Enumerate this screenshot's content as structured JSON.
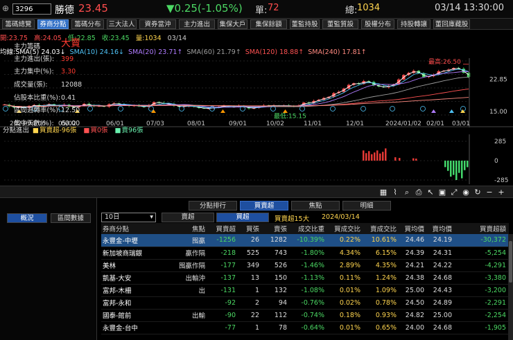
{
  "quote": {
    "code": "3296",
    "name": "勝德",
    "price": "23.45",
    "change": "▼0.25(-1.05%)",
    "vol_label": "單:",
    "vol": "72",
    "total_label": "總:",
    "total": "1034",
    "datetime": "03/14 13:30:00"
  },
  "tabs": [
    "籌碼總覽",
    "券商分點",
    "籌碼分布",
    "三大法人",
    "資券當沖",
    "主力進出",
    "集保大戶",
    "集保餘額",
    "董監持股",
    "董監質設",
    "股權分布",
    "持股轉讓",
    "董回庫藏股"
  ],
  "tab_active": 1,
  "price_bar": {
    "open": "開:23.75",
    "high": "高:24.05",
    "low": "低:22.85",
    "close": "收:23.45",
    "vol": "量:1034",
    "date": "03/14"
  },
  "ma_legend": [
    {
      "label": "均線:SMA(5) 24.03↓",
      "color": "#ffffff"
    },
    {
      "label": "SMA(10) 24.16↓",
      "color": "#4fc3f7"
    },
    {
      "label": "SMA(20) 23.71↑",
      "color": "#b07cff"
    },
    {
      "label": "SMA(60) 21.79↑",
      "color": "#9e9e9e"
    },
    {
      "label": "SMA(120) 18.88↑",
      "color": "#ff5252"
    },
    {
      "label": "SMA(240) 17.81↑",
      "color": "#ff8a80"
    }
  ],
  "chart_data": {
    "type": "candlestick",
    "x_ticks": [
      "2023/04/06",
      "05/02",
      "06/01",
      "07/03",
      "08/01",
      "09/01",
      "10/02",
      "11/01",
      "12/01",
      "2024/01/02",
      "02/01",
      "03/01"
    ],
    "y_ticks": [
      "22.85",
      "15.00"
    ],
    "annotations": {
      "high": "最高:26.50",
      "low": "最低:15.15"
    },
    "closes": [
      16.7,
      16.3,
      16.0,
      16.1,
      15.9,
      16.4,
      16.6,
      16.3,
      16.6,
      16.8,
      16.5,
      16.4,
      16.7,
      16.2,
      16.1,
      16.4,
      16.9,
      16.6,
      16.3,
      16.4,
      16.2,
      16.8,
      17.0,
      16.8,
      16.6,
      16.4,
      16.5,
      16.3,
      16.1,
      16.6,
      17.3,
      17.1,
      16.9,
      16.9,
      16.4,
      16.2,
      16.3,
      16.4,
      16.2,
      15.9,
      15.8,
      15.8,
      16.0,
      16.2,
      16.4,
      16.3,
      16.2,
      16.4,
      16.1,
      15.8,
      15.9,
      16.2,
      16.5,
      16.4,
      16.5,
      16.4,
      16.5,
      16.4,
      16.3,
      16.5,
      17.2,
      17.0,
      17.6,
      17.9,
      18.3,
      18.6,
      19.5,
      19.8,
      20.6,
      21.5,
      21.9,
      21.7,
      22.4,
      22.2,
      21.4,
      21.1,
      20.9,
      21.3,
      21.6,
      22.8,
      23.9,
      24.4,
      24.9,
      24.3,
      23.4,
      23.6,
      24.0,
      24.8,
      24.9,
      25.2,
      25.6,
      25.4,
      24.4,
      23.45
    ],
    "indicator": {
      "title": "分點進出",
      "series": [
        {
          "name": "買賣超-96張",
          "color": "#ffd54f"
        },
        {
          "name": "買0張",
          "color": "#ff5252"
        },
        {
          "name": "賣96張",
          "color": "#69f0ae"
        }
      ],
      "y_ticks": [
        "285",
        "0",
        "-285"
      ]
    }
  },
  "toolbar_icons": [
    "grid-icon",
    "chart-style-icon",
    "search-chart-icon",
    "print-icon",
    "cursor-icon",
    "fit-icon",
    "zoom-fit-icon",
    "eye-icon",
    "refresh-icon",
    "minus-icon",
    "plus-icon"
  ],
  "subtabs": [
    {
      "label": "分點排行",
      "active": false
    },
    {
      "label": "買賣超",
      "active": true
    },
    {
      "label": "焦點",
      "active": false
    },
    {
      "label": "明細",
      "active": false
    }
  ],
  "left_tabs": [
    "概況",
    "區間數據"
  ],
  "period": "10日",
  "filter": {
    "buy": "賣超",
    "sell": "買超",
    "active": 1
  },
  "filter_info": "買賣超15大",
  "filter_date": "2024/03/14",
  "summary": [
    {
      "k": "主力籌碼",
      "v": "大賣",
      "c": "#ff3b30"
    },
    {
      "k": "主力進出(張):",
      "v": "399",
      "c": "#ff3b30"
    },
    {
      "k": "主力集中(%):",
      "v": "3.30",
      "c": "#ff3b30"
    },
    {
      "k": "成交量(張):",
      "v": "12088",
      "c": "#dddddd"
    },
    {
      "k": "佔股本比重(%):",
      "v": "0.41",
      "c": "#dddddd"
    },
    {
      "k": "區間週轉率(%):",
      "v": "12.50",
      "c": "#dddddd"
    },
    {
      "k": "集中天數(%):",
      "v": "60.00",
      "c": "#dddddd"
    }
  ],
  "table_headers": [
    "券商分點",
    "焦點",
    "買賣超",
    "買張",
    "賣張",
    "成交比重",
    "買成交比",
    "賣成交比",
    "買均價",
    "賣均價",
    "買賣超額"
  ],
  "rows": [
    [
      "永豐金-中壢",
      "囤贏",
      "-1256",
      "26",
      "1282",
      "-10.39%",
      "0.22%",
      "10.61%",
      "24.46",
      "24.19",
      "-30,372"
    ],
    [
      "新加坡商瑞銀",
      "贏作隔",
      "-218",
      "525",
      "743",
      "-1.80%",
      "4.34%",
      "6.15%",
      "24.39",
      "24.31",
      "-5,254"
    ],
    [
      "美林",
      "囤贏作隔",
      "-177",
      "349",
      "526",
      "-1.46%",
      "2.89%",
      "4.35%",
      "24.21",
      "24.22",
      "-4,291"
    ],
    [
      "凱基-大安",
      "出輸沖",
      "-137",
      "13",
      "150",
      "-1.13%",
      "0.11%",
      "1.24%",
      "24.38",
      "24.68",
      "-3,380"
    ],
    [
      "富邦-木柵",
      "出",
      "-131",
      "1",
      "132",
      "-1.08%",
      "0.01%",
      "1.09%",
      "25.00",
      "24.43",
      "-3,200"
    ],
    [
      "富邦-永和",
      "",
      "-92",
      "2",
      "94",
      "-0.76%",
      "0.02%",
      "0.78%",
      "24.50",
      "24.89",
      "-2,291"
    ],
    [
      "國泰-館前",
      "出輸",
      "-90",
      "22",
      "112",
      "-0.74%",
      "0.18%",
      "0.93%",
      "24.82",
      "25.00",
      "-2,254"
    ],
    [
      "永豐金-台中",
      "",
      "-77",
      "1",
      "78",
      "-0.64%",
      "0.01%",
      "0.65%",
      "24.00",
      "24.68",
      "-1,905"
    ]
  ]
}
